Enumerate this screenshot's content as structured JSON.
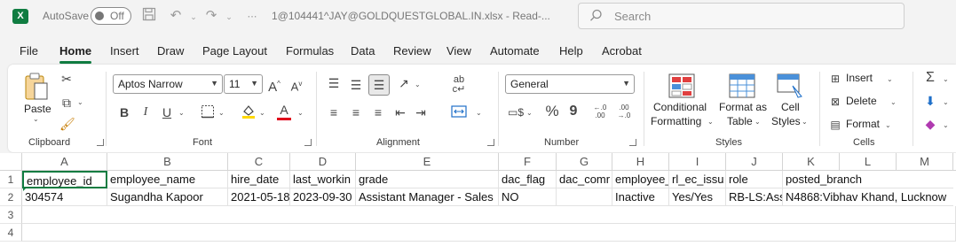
{
  "titlebar": {
    "app_icon": "X",
    "autosave_label": "AutoSave",
    "autosave_state": "Off",
    "file_title": "1@104441^JAY@GOLDQUESTGLOBAL.IN.xlsx - Read-...",
    "search_placeholder": "Search"
  },
  "menu": {
    "tabs": [
      "File",
      "Home",
      "Insert",
      "Draw",
      "Page Layout",
      "Formulas",
      "Data",
      "Review",
      "View",
      "Automate",
      "Help",
      "Acrobat"
    ],
    "active": "Home"
  },
  "ribbon": {
    "clipboard": {
      "paste_label": "Paste",
      "group_label": "Clipboard"
    },
    "font": {
      "font_name": "Aptos Narrow",
      "font_size": "11",
      "bold": "B",
      "italic": "I",
      "underline": "U",
      "grow": "A",
      "shrink": "A",
      "font_color_glyph": "A",
      "group_label": "Font"
    },
    "alignment": {
      "group_label": "Alignment"
    },
    "number": {
      "format": "General",
      "percent": "%",
      "comma": "9",
      "inc_decimal": "←.0 .00",
      "dec_decimal": ".00 →.0",
      "group_label": "Number"
    },
    "styles": {
      "conditional_1": "Conditional",
      "conditional_2": "Formatting",
      "format_table_1": "Format as",
      "format_table_2": "Table",
      "cell_styles_1": "Cell",
      "cell_styles_2": "Styles",
      "group_label": "Styles"
    },
    "cells": {
      "insert": "Insert",
      "delete": "Delete",
      "format": "Format",
      "group_label": "Cells"
    },
    "colors": {
      "accent": "#107c41",
      "highlight": "#ffd800",
      "font_color": "#e0001b"
    }
  },
  "sheet": {
    "columns": [
      "A",
      "B",
      "C",
      "D",
      "E",
      "F",
      "G",
      "H",
      "I",
      "J",
      "K",
      "L",
      "M"
    ],
    "rows": [
      "1",
      "2",
      "3",
      "4"
    ],
    "data": [
      [
        "employee_id",
        "employee_name",
        "hire_date",
        "last_workin",
        "grade",
        "dac_flag",
        "dac_comr",
        "employee_",
        "rl_ec_issu",
        "role",
        "posted_branch",
        "",
        ""
      ],
      [
        "304574",
        "Sugandha Kapoor",
        "2021-05-18",
        "2023-09-30",
        "Assistant Manager - Sales",
        "NO",
        "",
        "Inactive",
        "Yes/Yes",
        "RB-LS:Ass",
        "N4868:Vibhav Khand, Lucknow",
        "",
        ""
      ]
    ]
  }
}
